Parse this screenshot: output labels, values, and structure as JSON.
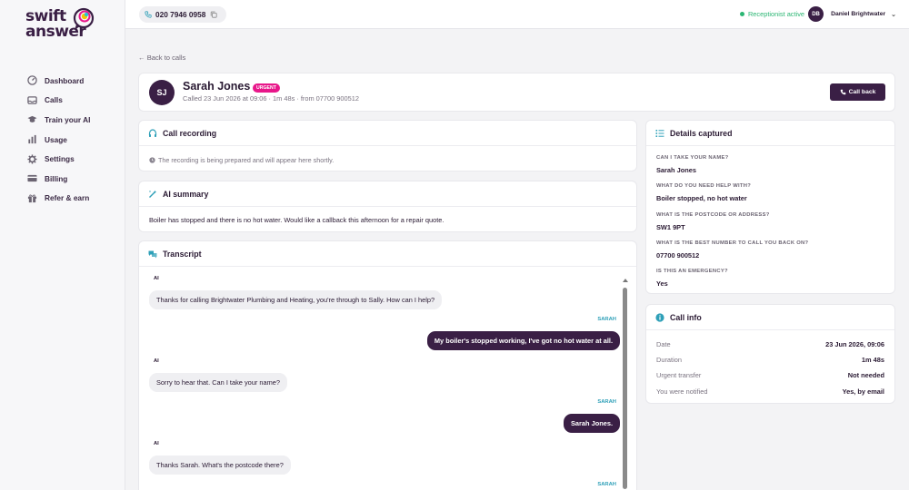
{
  "brand": {
    "logo_line1": "swift",
    "logo_line2": "answer"
  },
  "sidebar": {
    "items": [
      {
        "label": "Dashboard",
        "icon": "dashboard-icon"
      },
      {
        "label": "Calls",
        "icon": "inbox-icon"
      },
      {
        "label": "Train your AI",
        "icon": "graduation-cap-icon"
      },
      {
        "label": "Usage",
        "icon": "bar-chart-icon"
      },
      {
        "label": "Settings",
        "icon": "gear-icon"
      },
      {
        "label": "Billing",
        "icon": "credit-card-icon"
      },
      {
        "label": "Refer & earn",
        "icon": "gift-icon"
      }
    ]
  },
  "topbar": {
    "phone_number": "020 7946 0958",
    "status": "Receptionist active",
    "status_color": "#2bb673",
    "user_initials": "DB",
    "user_name": "Daniel Brightwater"
  },
  "back_link": "← Back to calls",
  "call": {
    "initials": "SJ",
    "caller_name": "Sarah Jones",
    "badge": "URGENT",
    "badge_color": "#e8178a",
    "meta": "Called 23 Jun 2026 at 09:06 · 1m 48s · from 07700 900512",
    "callback_label": "Call back"
  },
  "recording": {
    "title": "Call recording",
    "note": "The recording is being prepared and will appear here shortly."
  },
  "summary": {
    "title": "AI summary",
    "text": "Boiler has stopped and there is no hot water. Would like a callback this afternoon for a repair quote."
  },
  "transcript": {
    "title": "Transcript",
    "messages": [
      {
        "speaker": "AI",
        "text": "Thanks for calling Brightwater Plumbing and Heating, you're through to Sally. How can I help?"
      },
      {
        "speaker": "SARAH",
        "text": "My boiler's stopped working, I've got no hot water at all."
      },
      {
        "speaker": "AI",
        "text": "Sorry to hear that. Can I take your name?"
      },
      {
        "speaker": "SARAH",
        "text": "Sarah Jones."
      },
      {
        "speaker": "AI",
        "text": "Thanks Sarah. What's the postcode there?"
      },
      {
        "speaker": "SARAH",
        "text": ""
      }
    ]
  },
  "details": {
    "title": "Details captured",
    "items": [
      {
        "question": "CAN I TAKE YOUR NAME?",
        "answer": "Sarah Jones"
      },
      {
        "question": "WHAT DO YOU NEED HELP WITH?",
        "answer": "Boiler stopped, no hot water"
      },
      {
        "question": "WHAT IS THE POSTCODE OR ADDRESS?",
        "answer": "SW1 9PT"
      },
      {
        "question": "WHAT IS THE BEST NUMBER TO CALL YOU BACK ON?",
        "answer": "07700 900512"
      },
      {
        "question": "IS THIS AN EMERGENCY?",
        "answer": "Yes"
      }
    ]
  },
  "call_info": {
    "title": "Call info",
    "rows": [
      {
        "label": "Date",
        "value": "23 Jun 2026, 09:06"
      },
      {
        "label": "Duration",
        "value": "1m 48s"
      },
      {
        "label": "Urgent transfer",
        "value": "Not needed"
      },
      {
        "label": "You were notified",
        "value": "Yes, by email"
      }
    ]
  }
}
